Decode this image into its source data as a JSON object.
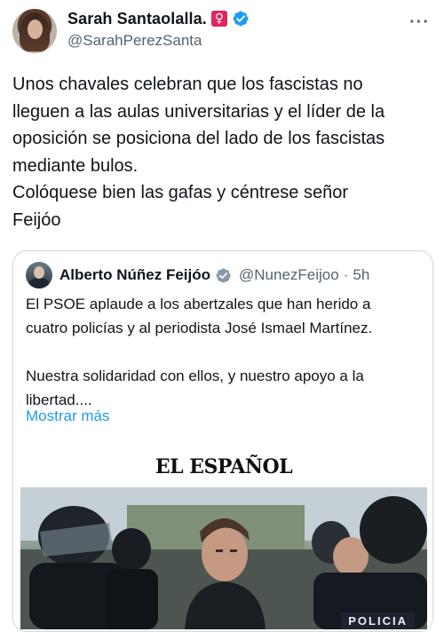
{
  "tweet": {
    "author": {
      "display_name": "Sarah Santaolalla.",
      "badge": "♀",
      "handle": "@SarahPerezSanta"
    },
    "more_icon": "more-options-icon",
    "text": "Unos chavales celebran que los fascistas no\nlleguen a las aulas universitarias y el líder de la\noposición se posiciona del lado de los fascistas\nmediante bulos.\nColóquese bien las gafas y céntrese señor\nFeijóo"
  },
  "quoted_tweet": {
    "author": {
      "display_name": "Alberto Núñez Feijóo",
      "handle": "@NunezFeijoo",
      "time": "5h"
    },
    "separator": "·",
    "text": "El PSOE aplaude a los abertzales que han herido a\ncuatro policías y al periodista José Ismael Martínez.\n\nNuestra solidaridad con ellos, y nuestro apoyo a la\nlibertad....",
    "show_more_label": "Mostrar más",
    "media": {
      "masthead": "EL ESPAÑOL",
      "sign_text": "POLICIA"
    }
  },
  "colors": {
    "verified_blue": "#1d9bf0",
    "verified_gray": "#829aab",
    "venus_badge": "#e0245e",
    "link": "#1d9bf0",
    "secondary_text": "#536471"
  }
}
